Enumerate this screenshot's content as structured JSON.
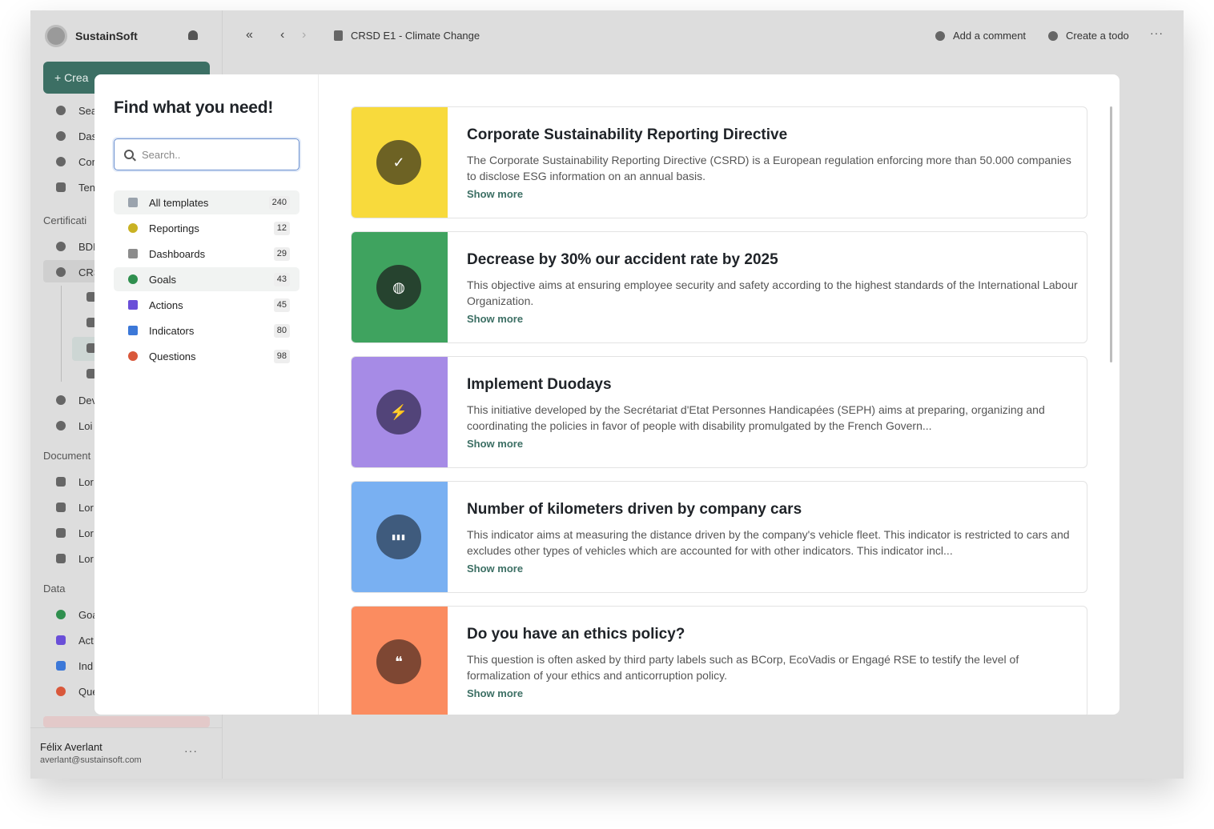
{
  "workspace": {
    "name": "SustainSoft"
  },
  "sidebar": {
    "create_label": "+ Crea",
    "items_top": [
      "Sea",
      "Das",
      "Cor",
      "Ten"
    ],
    "section_certifications": "Certificati",
    "cert_items": [
      "BDI",
      "CRS",
      "Dev",
      "Loi"
    ],
    "section_documents": "Document",
    "doc_items": [
      "Lor",
      "Lor",
      "Lor",
      "Lor"
    ],
    "section_data": "Data",
    "data_items": [
      "Goa",
      "Act",
      "Ind",
      "Que"
    ]
  },
  "user": {
    "name": "Félix Averlant",
    "email": "averlant@sustainsoft.com",
    "more": "···"
  },
  "topbar": {
    "collapse": "«",
    "back": "‹",
    "forward": "›",
    "breadcrumb": "CRSD E1 - Climate Change",
    "add_comment": "Add a comment",
    "create_todo": "Create a todo",
    "more": "···"
  },
  "modal": {
    "title": "Find what you need!",
    "search_placeholder": "Search..",
    "categories": [
      {
        "label": "All templates",
        "count": "240",
        "color": "#9aa3ad"
      },
      {
        "label": "Reportings",
        "count": "12",
        "color": "#c9b223"
      },
      {
        "label": "Dashboards",
        "count": "29",
        "color": "#8c8c8c"
      },
      {
        "label": "Goals",
        "count": "43",
        "color": "#2f8f4e"
      },
      {
        "label": "Actions",
        "count": "45",
        "color": "#6a4fd8"
      },
      {
        "label": "Indicators",
        "count": "80",
        "color": "#3c78d8"
      },
      {
        "label": "Questions",
        "count": "98",
        "color": "#d9583b"
      }
    ],
    "cards": [
      {
        "title": "Corporate Sustainability Reporting Directive",
        "desc": "The Corporate Sustainability Reporting Directive (CSRD) is a European regulation enforcing more than 50.000 companies to disclose ESG information on an annual basis.",
        "more": "Show more",
        "bg": "#f8da3c",
        "badge": "#6d6224",
        "icon": "check-badge-icon",
        "glyph": "✓"
      },
      {
        "title": "Decrease by 30% our accident rate by 2025",
        "desc": "This objective aims at ensuring employee security and safety according to the highest standards of the International Labour Organization.",
        "more": "Show more",
        "bg": "#3fa35f",
        "badge": "#26432f",
        "icon": "globe-icon",
        "glyph": "◍"
      },
      {
        "title": "Implement Duodays",
        "desc": "This initiative developed by the Secrétariat d'Etat Personnes Handicapées (SEPH) aims at preparing, organizing and coordinating the policies in favor of people with disability promulgated by the French Govern...",
        "more": "Show more",
        "bg": "#a68be6",
        "badge": "#524479",
        "icon": "lightning-icon",
        "glyph": "⚡"
      },
      {
        "title": "Number of kilometers driven by company cars",
        "desc": "This indicator aims at measuring the distance driven by the company's vehicle fleet. This indicator is restricted to cars and excludes other types of vehicles which are accounted for with other indicators. This indicator incl...",
        "more": "Show more",
        "bg": "#79b0f2",
        "badge": "#3f5b7d",
        "icon": "bar-chart-icon",
        "glyph": "▮▮▮"
      },
      {
        "title": "Do you have an ethics policy?",
        "desc": "This question is often asked by third party labels such as BCorp, EcoVadis or Engagé RSE to testify the level of formalization of your ethics and anticorruption policy.",
        "more": "Show more",
        "bg": "#fb8c60",
        "badge": "#7e4733",
        "icon": "speech-bubbles-icon",
        "glyph": "❝"
      }
    ]
  }
}
